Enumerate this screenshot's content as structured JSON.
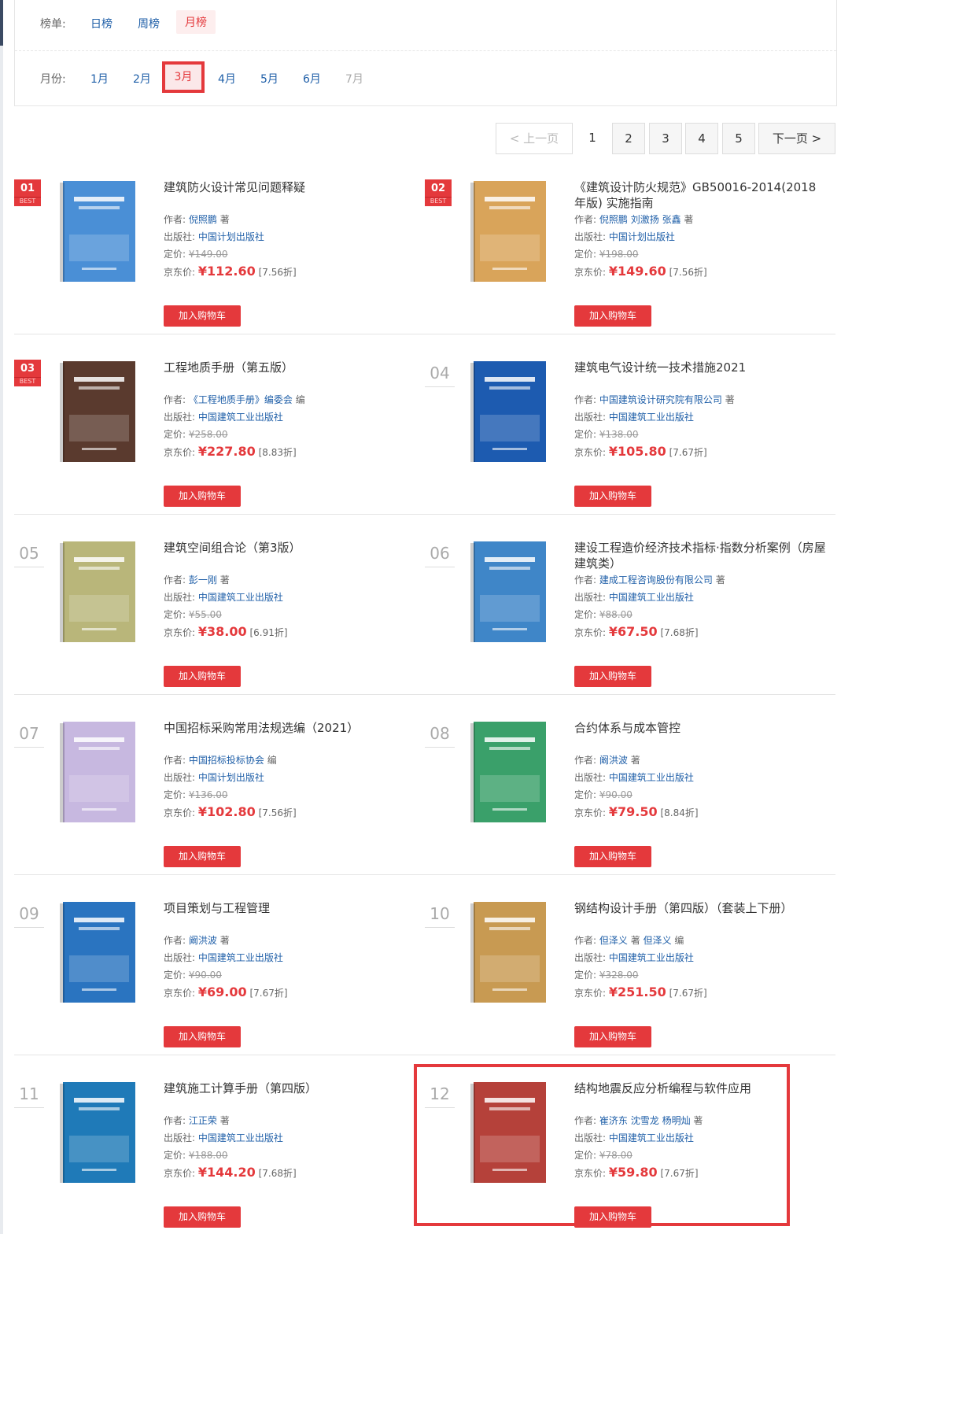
{
  "filters": {
    "board_label": "榜单:",
    "board_options": [
      "日榜",
      "周榜",
      "月榜"
    ],
    "board_active": "月榜",
    "month_label": "月份:",
    "month_options": [
      "1月",
      "2月",
      "3月",
      "4月",
      "5月",
      "6月",
      "7月"
    ],
    "month_active": "3月"
  },
  "pagination": {
    "prev": "< 上一页",
    "pages": [
      "1",
      "2",
      "3",
      "4",
      "5"
    ],
    "current": "1",
    "next": "下一页 >"
  },
  "labels": {
    "author": "作者:",
    "publisher": "出版社:",
    "list_price": "定价:",
    "jd_price": "京东价:",
    "add_to_cart": "加入购物车",
    "best": "BEST"
  },
  "books": [
    {
      "rank": "01",
      "best": true,
      "title": "建筑防火设计常见问题释疑",
      "authors": [
        "倪照鹏"
      ],
      "author_role": "著",
      "publisher": "中国计划出版社",
      "list_price": "¥149.00",
      "jd_price": "¥112.60",
      "discount": "[7.56折]",
      "cover_color": "#4a8fd6"
    },
    {
      "rank": "02",
      "best": true,
      "title": "《建筑设计防火规范》GB50016-2014(2018年版) 实施指南",
      "authors": [
        "倪照鹏",
        "刘激扬",
        "张鑫"
      ],
      "author_role": "著",
      "publisher": "中国计划出版社",
      "list_price": "¥198.00",
      "jd_price": "¥149.60",
      "discount": "[7.56折]",
      "cover_color": "#d9a45a"
    },
    {
      "rank": "03",
      "best": true,
      "title": "工程地质手册（第五版）",
      "authors": [
        "《工程地质手册》编委会"
      ],
      "author_role": "编",
      "publisher": "中国建筑工业出版社",
      "list_price": "¥258.00",
      "jd_price": "¥227.80",
      "discount": "[8.83折]",
      "cover_color": "#5a3a2e"
    },
    {
      "rank": "04",
      "best": false,
      "title": "建筑电气设计统一技术措施2021",
      "authors": [
        "中国建筑设计研究院有限公司"
      ],
      "author_role": "著",
      "publisher": "中国建筑工业出版社",
      "list_price": "¥138.00",
      "jd_price": "¥105.80",
      "discount": "[7.67折]",
      "cover_color": "#1d5bb0"
    },
    {
      "rank": "05",
      "best": false,
      "title": "建筑空间组合论（第3版）",
      "authors": [
        "彭一刚"
      ],
      "author_role": "著",
      "publisher": "中国建筑工业出版社",
      "list_price": "¥55.00",
      "jd_price": "¥38.00",
      "discount": "[6.91折]",
      "cover_color": "#b9b67a"
    },
    {
      "rank": "06",
      "best": false,
      "title": "建设工程造价经济技术指标·指数分析案例（房屋建筑类）",
      "authors": [
        "建成工程咨询股份有限公司"
      ],
      "author_role": "著",
      "publisher": "中国建筑工业出版社",
      "list_price": "¥88.00",
      "jd_price": "¥67.50",
      "discount": "[7.68折]",
      "cover_color": "#3f86c8"
    },
    {
      "rank": "07",
      "best": false,
      "title": "中国招标采购常用法规选编（2021）",
      "authors": [
        "中国招标投标协会"
      ],
      "author_role": "编",
      "publisher": "中国计划出版社",
      "list_price": "¥136.00",
      "jd_price": "¥102.80",
      "discount": "[7.56折]",
      "cover_color": "#c7b8e0"
    },
    {
      "rank": "08",
      "best": false,
      "title": "合约体系与成本管控",
      "authors": [
        "阚洪波"
      ],
      "author_role": "著",
      "publisher": "中国建筑工业出版社",
      "list_price": "¥90.00",
      "jd_price": "¥79.50",
      "discount": "[8.84折]",
      "cover_color": "#3aa06a"
    },
    {
      "rank": "09",
      "best": false,
      "title": "项目策划与工程管理",
      "authors": [
        "阚洪波"
      ],
      "author_role": "著",
      "publisher": "中国建筑工业出版社",
      "list_price": "¥90.00",
      "jd_price": "¥69.00",
      "discount": "[7.67折]",
      "cover_color": "#2a74c0"
    },
    {
      "rank": "10",
      "best": false,
      "title": "钢结构设计手册（第四版）（套装上下册）",
      "authors": [
        "但泽义",
        "但泽义"
      ],
      "author_roles": [
        "著",
        "编"
      ],
      "author_role": "编",
      "publisher": "中国建筑工业出版社",
      "list_price": "¥328.00",
      "jd_price": "¥251.50",
      "discount": "[7.67折]",
      "cover_color": "#c89a52"
    },
    {
      "rank": "11",
      "best": false,
      "title": "建筑施工计算手册（第四版）",
      "authors": [
        "江正荣"
      ],
      "author_role": "著",
      "publisher": "中国建筑工业出版社",
      "list_price": "¥188.00",
      "jd_price": "¥144.20",
      "discount": "[7.68折]",
      "cover_color": "#1f7ab8"
    },
    {
      "rank": "12",
      "best": false,
      "title": "结构地震反应分析编程与软件应用",
      "authors": [
        "崔济东",
        "沈雪龙",
        "杨明灿"
      ],
      "author_role": "著",
      "publisher": "中国建筑工业出版社",
      "list_price": "¥78.00",
      "jd_price": "¥59.80",
      "discount": "[7.67折]",
      "cover_color": "#b5413a"
    }
  ]
}
